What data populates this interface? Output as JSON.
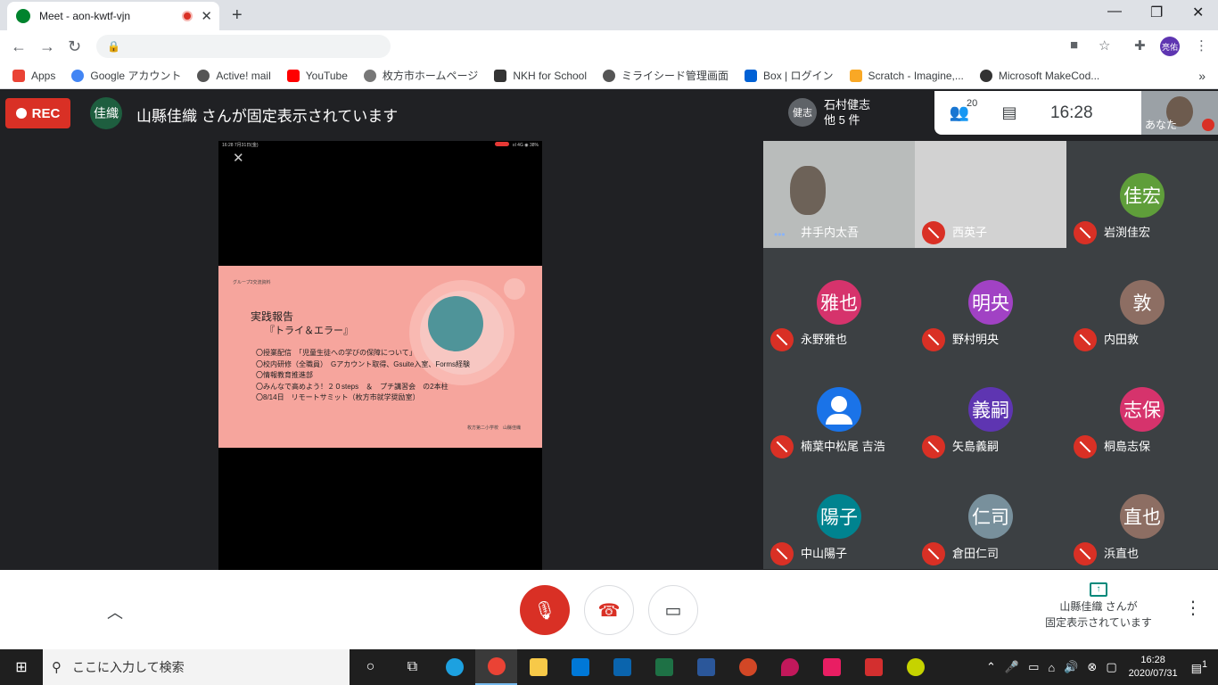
{
  "browser": {
    "tab_title": "Meet - aon-kwtf-vjn",
    "new_tab": "+",
    "win_minimize": "—",
    "win_restore": "❐",
    "win_close": "✕",
    "profile_initials": "亮佑",
    "bookmarks": [
      "Apps",
      "Google アカウント",
      "Active! mail",
      "YouTube",
      "枚方市ホームページ",
      "NKH for School",
      "ミライシード管理画面",
      "Box | ログイン",
      "Scratch - Imagine,...",
      "Microsoft MakeCod..."
    ],
    "bookmarks_more": "»"
  },
  "meet": {
    "rec_label": "REC",
    "pinned_avatar": "佳織",
    "pinned_text": "山縣佳織 さんが固定表示されています",
    "guests_avatar": "健志",
    "guests_name": "石村健志",
    "guests_more": "他 5 件",
    "participant_count": "20",
    "clock": "16:28",
    "self_label": "あなた"
  },
  "slide": {
    "close": "✕",
    "status_left": "16:28  7月31日(金)",
    "status_right": "ııl 4G ◉ 38%",
    "header": "グループ2交流資料",
    "title": "実践報告",
    "subtitle": "『トライ＆エラー』",
    "lines": [
      "〇授業配信　「児童生徒への学びの保障について」",
      "〇校内研修（全職員）　Gアカウント取得、Gsuite入室、Forms経験",
      "〇情報教育推進部",
      "〇みんなで高めよう！２０steps　＆　プチ講習会　の2本柱",
      "〇8/14日　リモートサミット（枚方市就学奨励室）"
    ],
    "footer": "枚方第二小学校　山縣佳織"
  },
  "participants": [
    {
      "name": "井手内太吾",
      "initials": "",
      "color": "#b9bcbb",
      "video": true
    },
    {
      "name": "西英子",
      "initials": "",
      "color": "#d2d2d2",
      "video": true
    },
    {
      "name": "岩渕佳宏",
      "initials": "佳宏",
      "color": "#5f9e3a",
      "video": false
    },
    {
      "name": "永野雅也",
      "initials": "雅也",
      "color": "#d6336c",
      "video": false
    },
    {
      "name": "野村明央",
      "initials": "明央",
      "color": "#a142c4",
      "video": false
    },
    {
      "name": "内田敦",
      "initials": "敦",
      "color": "#8d6e63",
      "video": false
    },
    {
      "name": "楠葉中松尾 吉浩",
      "initials": "",
      "color": "#1a73e8",
      "video": false
    },
    {
      "name": "矢島義嗣",
      "initials": "義嗣",
      "color": "#5e35b1",
      "video": false
    },
    {
      "name": "桐島志保",
      "initials": "志保",
      "color": "#d6336c",
      "video": false
    },
    {
      "name": "中山陽子",
      "initials": "陽子",
      "color": "#00838f",
      "video": false
    },
    {
      "name": "倉田仁司",
      "initials": "仁司",
      "color": "#78909c",
      "video": false
    },
    {
      "name": "浜直也",
      "initials": "直也",
      "color": "#8d6e63",
      "video": false
    }
  ],
  "controls": {
    "presenting_line1": "山縣佳織 さんが",
    "presenting_line2": "固定表示されています"
  },
  "taskbar": {
    "search_placeholder": "ここに入力して検索",
    "time": "16:28",
    "date": "2020/07/31",
    "notif_count": "1"
  }
}
